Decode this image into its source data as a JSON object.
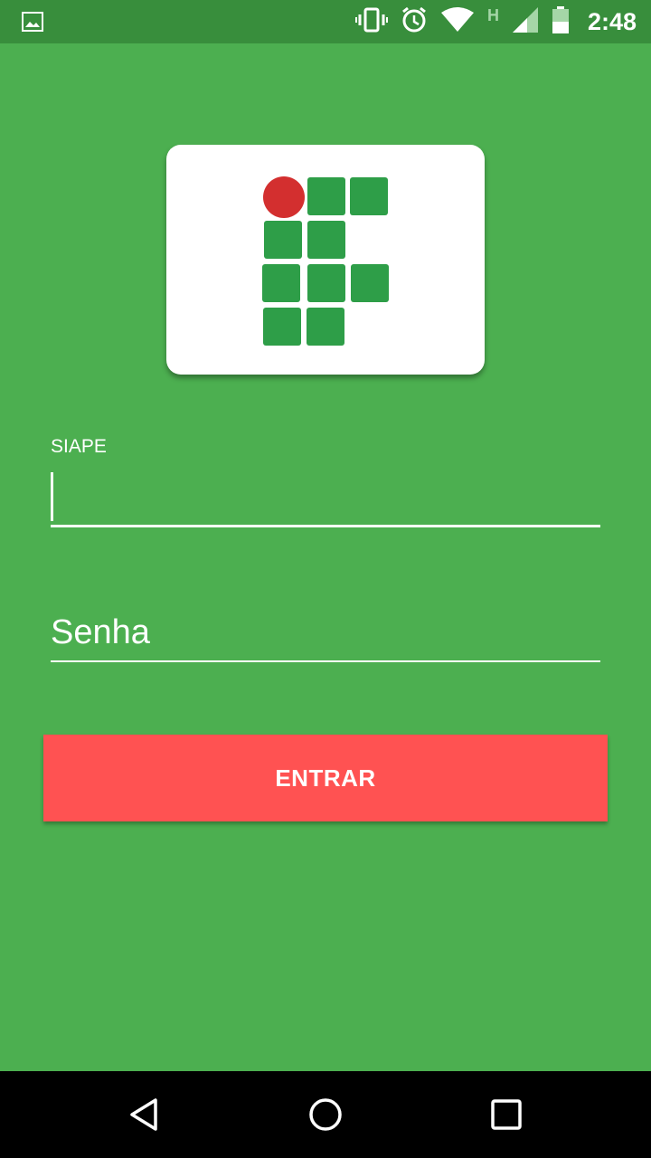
{
  "status_bar": {
    "time": "2:48",
    "network_letter": "H",
    "icons": [
      "gallery-icon",
      "vibrate-icon",
      "alarm-icon",
      "wifi-icon",
      "signal-icon",
      "battery-icon"
    ]
  },
  "logo": {
    "name": "institution-logo",
    "colors": {
      "green": "#2e9e48",
      "red": "#d32f2f"
    }
  },
  "form": {
    "siape_label": "SIAPE",
    "siape_value": "",
    "senha_placeholder": "Senha",
    "senha_value": ""
  },
  "button": {
    "entrar_label": "ENTRAR"
  },
  "colors": {
    "background": "#4caf50",
    "status_bar": "#388e3c",
    "button": "#ff5252",
    "text": "#ffffff"
  },
  "nav_bar": {
    "icons": [
      "back-icon",
      "home-icon",
      "recents-icon"
    ]
  }
}
